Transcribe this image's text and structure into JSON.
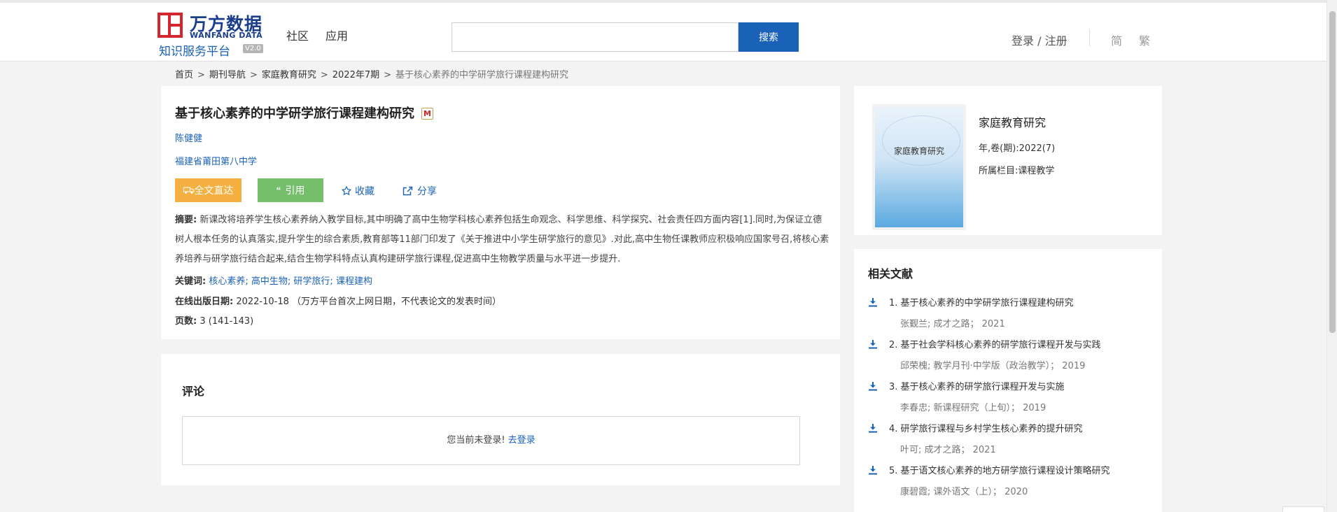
{
  "header": {
    "logo_cn": "万方数据",
    "logo_en": "WANFANG DATA",
    "logo_sub": "知识服务平台",
    "logo_version": "V2.0",
    "nav": [
      "社区",
      "应用"
    ],
    "search_value": "",
    "search_button": "搜索",
    "login": "登录 / 注册",
    "lang_simplified": "简",
    "lang_traditional": "繁"
  },
  "breadcrumb": [
    "首页",
    "期刊导航",
    "家庭教育研究",
    "2022年7期",
    "基于核心素养的中学研学旅行课程建构研究"
  ],
  "article": {
    "title": "基于核心素养的中学研学旅行课程建构研究",
    "badge": "M",
    "author": "陈健健",
    "organization": "福建省莆田第八中学",
    "actions": {
      "fulltext": "全文直达",
      "cite": "引用",
      "favorite": "收藏",
      "share": "分享"
    },
    "abstract_label": "摘要:",
    "abstract": "新课改将培养学生核心素养纳入教学目标,其中明确了高中生物学科核心素养包括生命观念、科学思维、科学探究、社会责任四方面内容[1].同时,为保证立德树人根本任务的认真落实,提升学生的综合素质,教育部等11部门印发了《关于推进中小学生研学旅行的意见》.对此,高中生物任课教师应积极响应国家号召,将核心素养培养与研学旅行结合起来,结合生物学科特点认真构建研学旅行课程,促进高中生物教学质量与水平进一步提升.",
    "keywords_label": "关键词:",
    "keywords": [
      "核心素养;",
      "高中生物;",
      "研学旅行;",
      "课程建构"
    ],
    "date_label": "在线出版日期:",
    "date_value": "2022-10-18",
    "date_note": "（万方平台首次上网日期，不代表论文的发表时间）",
    "pages_label": "页数:",
    "pages_value": "3 (141-143)"
  },
  "comment": {
    "title": "评论",
    "not_logged_in": "您当前未登录!",
    "go_login": "去登录"
  },
  "journal": {
    "cover_title": "家庭教育研究",
    "name": "家庭教育研究",
    "year_label": "年,卷(期):",
    "year_value": "2022(7)",
    "column_label": "所属栏目:",
    "column_value": "课程教学"
  },
  "related": {
    "title": "相关文献",
    "items": [
      {
        "name": "1.  基于核心素养的中学研学旅行课程建构研究",
        "meta": "张觐兰;  成才之路；  2021"
      },
      {
        "name": "2.  基于社会学科核心素养的研学旅行课程开发与实践",
        "meta": "邱荣槐;  教学月刊·中学版（政治教学）；  2019"
      },
      {
        "name": "3.  基于核心素养的研学旅行课程开发与实施",
        "meta": "李春忠;  新课程研究（上旬）；  2019"
      },
      {
        "name": "4.  研学旅行课程与乡村学生核心素养的提升研究",
        "meta": "叶可;  成才之路；  2021"
      },
      {
        "name": "5.  基于语文核心素养的地方研学旅行课程设计策略研究",
        "meta": "康碧霞;  课外语文（上）；  2020"
      }
    ]
  },
  "colors": {
    "brand_blue": "#1a62b8",
    "brand_red": "#d4262c",
    "fulltext_orange": "#f4b142",
    "cite_green": "#74be6c"
  }
}
